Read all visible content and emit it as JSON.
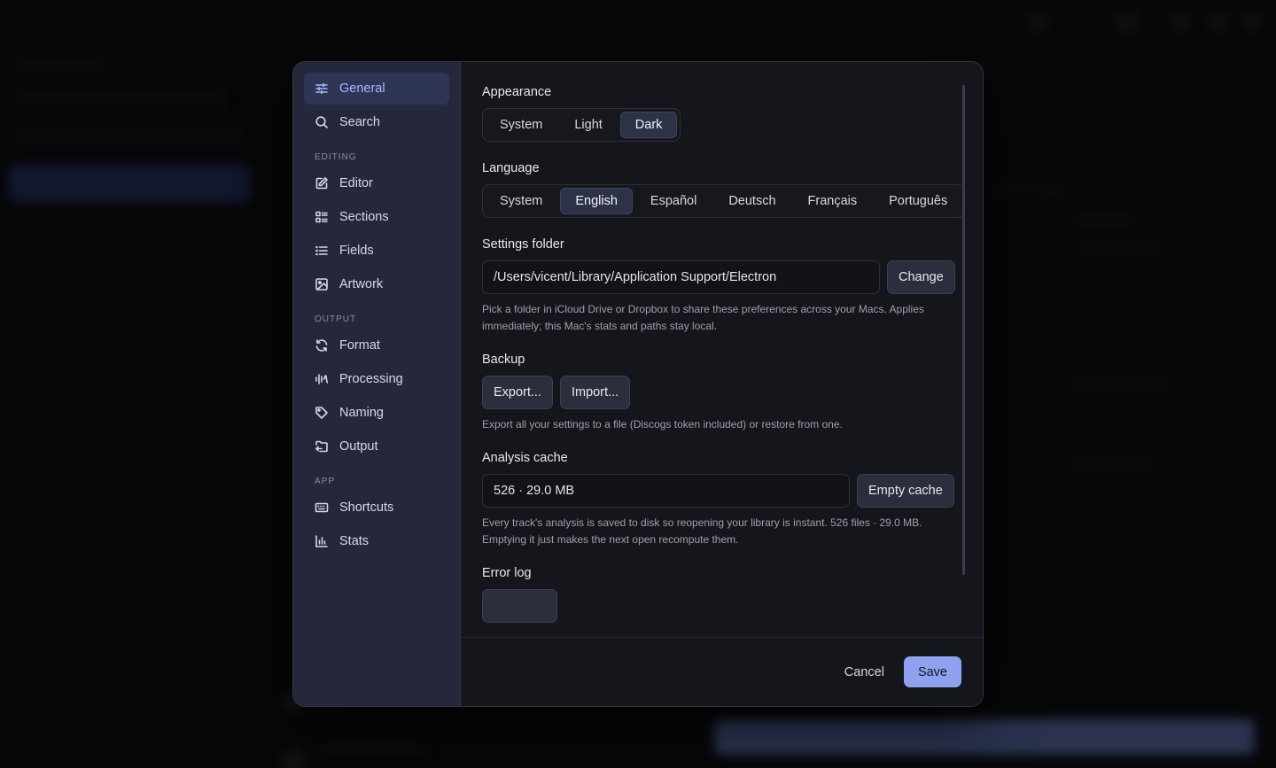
{
  "nav": {
    "items": [
      {
        "label": "General"
      },
      {
        "label": "Search"
      }
    ],
    "sections": [
      {
        "title": "EDITING",
        "items": [
          {
            "label": "Editor"
          },
          {
            "label": "Sections"
          },
          {
            "label": "Fields"
          },
          {
            "label": "Artwork"
          }
        ]
      },
      {
        "title": "OUTPUT",
        "items": [
          {
            "label": "Format"
          },
          {
            "label": "Processing"
          },
          {
            "label": "Naming"
          },
          {
            "label": "Output"
          }
        ]
      },
      {
        "title": "APP",
        "items": [
          {
            "label": "Shortcuts"
          },
          {
            "label": "Stats"
          }
        ]
      }
    ],
    "active": "General"
  },
  "appearance": {
    "title": "Appearance",
    "options": [
      "System",
      "Light",
      "Dark"
    ],
    "selected": "Dark"
  },
  "language": {
    "title": "Language",
    "options": [
      "System",
      "English",
      "Español",
      "Deutsch",
      "Français",
      "Português"
    ],
    "selected": "English"
  },
  "settings_folder": {
    "title": "Settings folder",
    "path": "/Users/vicent/Library/Application Support/Electron",
    "change_label": "Change",
    "help": "Pick a folder in iCloud Drive or Dropbox to share these preferences across your Macs. Applies immediately; this Mac's stats and paths stay local."
  },
  "backup": {
    "title": "Backup",
    "export_label": "Export...",
    "import_label": "Import...",
    "help": "Export all your settings to a file (Discogs token included) or restore from one."
  },
  "analysis_cache": {
    "title": "Analysis cache",
    "value": "526 · 29.0 MB",
    "empty_label": "Empty cache",
    "help": "Every track's analysis is saved to disk so reopening your library is instant. 526 files · 29.0 MB. Emptying it just makes the next open recompute them."
  },
  "error_log": {
    "title": "Error log"
  },
  "footer": {
    "cancel_label": "Cancel",
    "save_label": "Save"
  },
  "colors": {
    "accent": "#8ea2f0",
    "nav_bg": "#24283a",
    "modal_bg": "#15161b"
  }
}
